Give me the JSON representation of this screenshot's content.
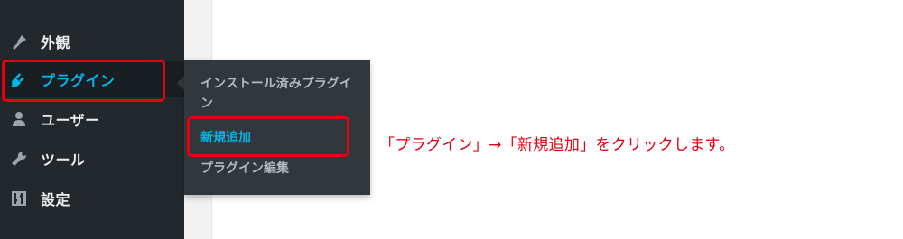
{
  "sidebar": {
    "items": [
      {
        "id": "appearance",
        "label": "外観",
        "icon": "brush-icon"
      },
      {
        "id": "plugins",
        "label": "プラグイン",
        "icon": "plugin-icon"
      },
      {
        "id": "users",
        "label": "ユーザー",
        "icon": "user-icon"
      },
      {
        "id": "tools",
        "label": "ツール",
        "icon": "wrench-icon"
      },
      {
        "id": "settings",
        "label": "設定",
        "icon": "settings-icon"
      }
    ]
  },
  "submenu": {
    "items": [
      {
        "label": "インストール済みプラグイン"
      },
      {
        "label": "新規追加"
      },
      {
        "label": "プラグイン編集"
      }
    ]
  },
  "annotation": {
    "text": "「プラグイン」→「新規追加」をクリックします。"
  },
  "colors": {
    "sidebar_bg": "#23282d",
    "flyout_bg": "#32373c",
    "accent": "#00b9eb",
    "highlight": "#e60012"
  }
}
